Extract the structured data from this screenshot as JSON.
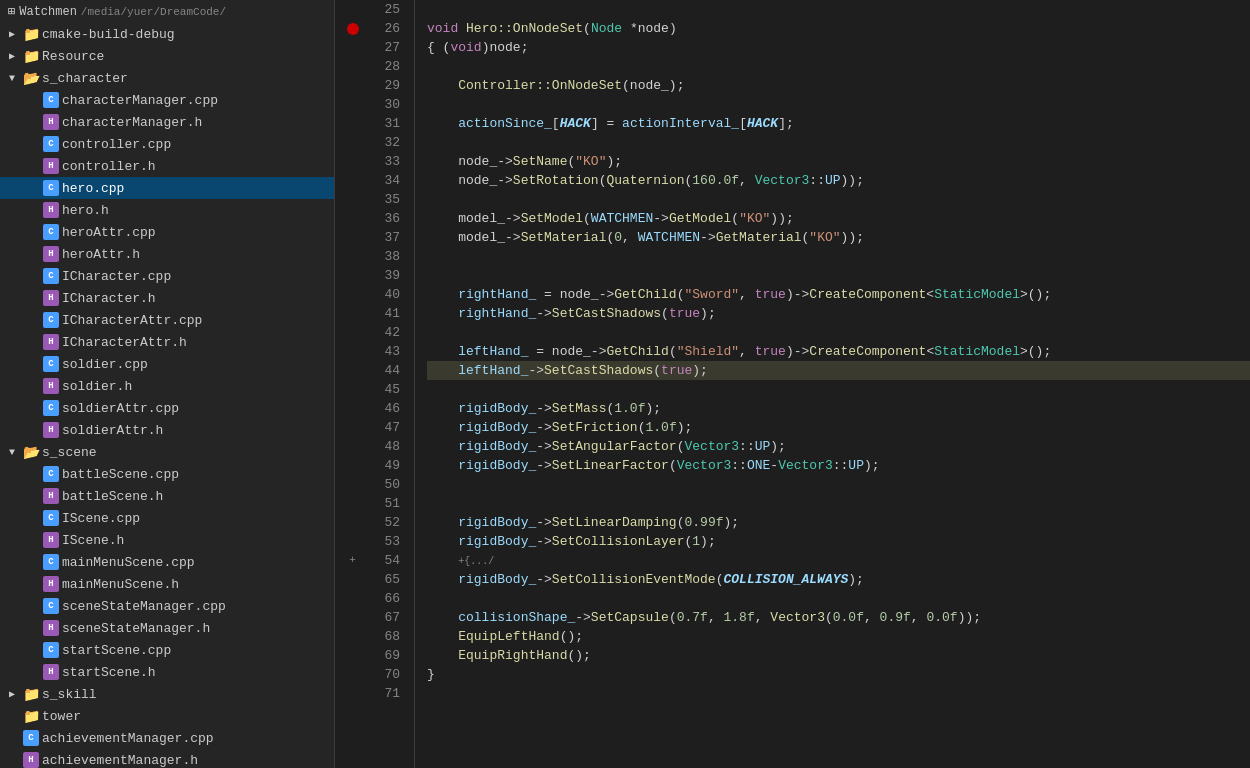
{
  "sidebar": {
    "root": {
      "label": "Watchmen",
      "path": "/media/yuer/DreamCode/"
    },
    "items": [
      {
        "type": "folder",
        "level": 1,
        "expand": "+",
        "label": "cmake-build-debug",
        "id": "cmake-build-debug"
      },
      {
        "type": "folder",
        "level": 1,
        "expand": "+",
        "label": "Resource",
        "id": "resource"
      },
      {
        "type": "folder",
        "level": 1,
        "expand": "-",
        "label": "s_character",
        "id": "s_character"
      },
      {
        "type": "file",
        "level": 2,
        "icon": "cpp",
        "label": "characterManager.cpp",
        "id": "characterManager-cpp"
      },
      {
        "type": "file",
        "level": 2,
        "icon": "h",
        "label": "characterManager.h",
        "id": "characterManager-h"
      },
      {
        "type": "file",
        "level": 2,
        "icon": "cpp",
        "label": "controller.cpp",
        "id": "controller-cpp"
      },
      {
        "type": "file",
        "level": 2,
        "icon": "h",
        "label": "controller.h",
        "id": "controller-h"
      },
      {
        "type": "file",
        "level": 2,
        "icon": "cpp",
        "label": "hero.cpp",
        "id": "hero-cpp",
        "selected": true
      },
      {
        "type": "file",
        "level": 2,
        "icon": "h",
        "label": "hero.h",
        "id": "hero-h"
      },
      {
        "type": "file",
        "level": 2,
        "icon": "cpp",
        "label": "heroAttr.cpp",
        "id": "heroAttr-cpp"
      },
      {
        "type": "file",
        "level": 2,
        "icon": "h",
        "label": "heroAttr.h",
        "id": "heroAttr-h"
      },
      {
        "type": "file",
        "level": 2,
        "icon": "cpp",
        "label": "ICharacter.cpp",
        "id": "ICharacter-cpp"
      },
      {
        "type": "file",
        "level": 2,
        "icon": "h",
        "label": "ICharacter.h",
        "id": "ICharacter-h"
      },
      {
        "type": "file",
        "level": 2,
        "icon": "cpp",
        "label": "ICharacterAttr.cpp",
        "id": "ICharacterAttr-cpp"
      },
      {
        "type": "file",
        "level": 2,
        "icon": "h",
        "label": "ICharacterAttr.h",
        "id": "ICharacterAttr-h"
      },
      {
        "type": "file",
        "level": 2,
        "icon": "cpp",
        "label": "soldier.cpp",
        "id": "soldier-cpp"
      },
      {
        "type": "file",
        "level": 2,
        "icon": "h",
        "label": "soldier.h",
        "id": "soldier-h"
      },
      {
        "type": "file",
        "level": 2,
        "icon": "cpp",
        "label": "soldierAttr.cpp",
        "id": "soldierAttr-cpp"
      },
      {
        "type": "file",
        "level": 2,
        "icon": "h",
        "label": "soldierAttr.h",
        "id": "soldierAttr-h"
      },
      {
        "type": "folder",
        "level": 1,
        "expand": "-",
        "label": "s_scene",
        "id": "s_scene"
      },
      {
        "type": "file",
        "level": 2,
        "icon": "cpp",
        "label": "battleScene.cpp",
        "id": "battleScene-cpp"
      },
      {
        "type": "file",
        "level": 2,
        "icon": "h",
        "label": "battleScene.h",
        "id": "battleScene-h"
      },
      {
        "type": "file",
        "level": 2,
        "icon": "cpp",
        "label": "IScene.cpp",
        "id": "IScene-cpp"
      },
      {
        "type": "file",
        "level": 2,
        "icon": "h",
        "label": "IScene.h",
        "id": "IScene-h"
      },
      {
        "type": "file",
        "level": 2,
        "icon": "cpp",
        "label": "mainMenuScene.cpp",
        "id": "mainMenuScene-cpp"
      },
      {
        "type": "file",
        "level": 2,
        "icon": "h",
        "label": "mainMenuScene.h",
        "id": "mainMenuScene-h"
      },
      {
        "type": "file",
        "level": 2,
        "icon": "cpp",
        "label": "sceneStateManager.cpp",
        "id": "sceneStateManager-cpp"
      },
      {
        "type": "file",
        "level": 2,
        "icon": "h",
        "label": "sceneStateManager.h",
        "id": "sceneStateManager-h"
      },
      {
        "type": "file",
        "level": 2,
        "icon": "cpp",
        "label": "startScene.cpp",
        "id": "startScene-cpp"
      },
      {
        "type": "file",
        "level": 2,
        "icon": "h",
        "label": "startScene.h",
        "id": "startScene-h"
      },
      {
        "type": "folder",
        "level": 1,
        "expand": "+",
        "label": "s_skill",
        "id": "s_skill"
      },
      {
        "type": "folder",
        "level": 1,
        "expand": null,
        "label": "tower",
        "id": "tower"
      },
      {
        "type": "file",
        "level": 1,
        "icon": "cpp",
        "label": "achievementManager.cpp",
        "id": "achievementManager-cpp"
      },
      {
        "type": "file",
        "level": 1,
        "icon": "h",
        "label": "achievementManager.h",
        "id": "achievementManager-h"
      }
    ]
  },
  "editor": {
    "filename": "hero.cpp",
    "lines": [
      {
        "num": 25,
        "content": "",
        "gutter": ""
      },
      {
        "num": 26,
        "content": "void Hero::OnNodeSet(Node *node)",
        "gutter": "bp"
      },
      {
        "num": 27,
        "content": "{ (void)node;",
        "gutter": ""
      },
      {
        "num": 28,
        "content": "",
        "gutter": ""
      },
      {
        "num": 29,
        "content": "    Controller::OnNodeSet(node_);",
        "gutter": ""
      },
      {
        "num": 30,
        "content": "",
        "gutter": ""
      },
      {
        "num": 31,
        "content": "    actionSince_[HACK] = actionInterval_[HACK];",
        "gutter": ""
      },
      {
        "num": 32,
        "content": "",
        "gutter": ""
      },
      {
        "num": 33,
        "content": "    node_->SetName(\"KO\");",
        "gutter": ""
      },
      {
        "num": 34,
        "content": "    node_->SetRotation(Quaternion(160.0f, Vector3::UP));",
        "gutter": ""
      },
      {
        "num": 35,
        "content": "",
        "gutter": ""
      },
      {
        "num": 36,
        "content": "    model_->SetModel(WATCHMEN->GetModel(\"KO\"));",
        "gutter": ""
      },
      {
        "num": 37,
        "content": "    model_->SetMaterial(0, WATCHMEN->GetMaterial(\"KO\"));",
        "gutter": ""
      },
      {
        "num": 38,
        "content": "",
        "gutter": ""
      },
      {
        "num": 39,
        "content": "",
        "gutter": ""
      },
      {
        "num": 40,
        "content": "    rightHand_ = node_->GetChild(\"Sword\", true)->CreateComponent<StaticModel>();",
        "gutter": ""
      },
      {
        "num": 41,
        "content": "    rightHand_->SetCastShadows(true);",
        "gutter": ""
      },
      {
        "num": 42,
        "content": "",
        "gutter": ""
      },
      {
        "num": 43,
        "content": "    leftHand_ = node_->GetChild(\"Shield\", true)->CreateComponent<StaticModel>();",
        "gutter": ""
      },
      {
        "num": 44,
        "content": "    leftHand_->SetCastShadows(true);",
        "gutter": "highlight"
      },
      {
        "num": 45,
        "content": "",
        "gutter": ""
      },
      {
        "num": 46,
        "content": "    rigidBody_->SetMass(1.0f);",
        "gutter": ""
      },
      {
        "num": 47,
        "content": "    rigidBody_->SetFriction(1.0f);",
        "gutter": ""
      },
      {
        "num": 48,
        "content": "    rigidBody_->SetAngularFactor(Vector3::UP);",
        "gutter": ""
      },
      {
        "num": 49,
        "content": "    rigidBody_->SetLinearFactor(Vector3::ONE-Vector3::UP);",
        "gutter": ""
      },
      {
        "num": 50,
        "content": "",
        "gutter": ""
      },
      {
        "num": 51,
        "content": "",
        "gutter": ""
      },
      {
        "num": 52,
        "content": "    rigidBody_->SetLinearDamping(0.99f);",
        "gutter": ""
      },
      {
        "num": 53,
        "content": "    rigidBody_->SetCollisionLayer(1);",
        "gutter": ""
      },
      {
        "num": 54,
        "content": "    {.../",
        "gutter": "fold"
      },
      {
        "num": 65,
        "content": "    rigidBody_->SetCollisionEventMode(COLLISION_ALWAYS);",
        "gutter": ""
      },
      {
        "num": 66,
        "content": "",
        "gutter": ""
      },
      {
        "num": 67,
        "content": "    collisionShape_->SetCapsule(0.7f, 1.8f, Vector3(0.0f, 0.9f, 0.0f));",
        "gutter": ""
      },
      {
        "num": 68,
        "content": "    EquipLeftHand();",
        "gutter": ""
      },
      {
        "num": 69,
        "content": "    EquipRightHand();",
        "gutter": ""
      },
      {
        "num": 70,
        "content": "}",
        "gutter": ""
      },
      {
        "num": 71,
        "content": "",
        "gutter": ""
      }
    ]
  }
}
